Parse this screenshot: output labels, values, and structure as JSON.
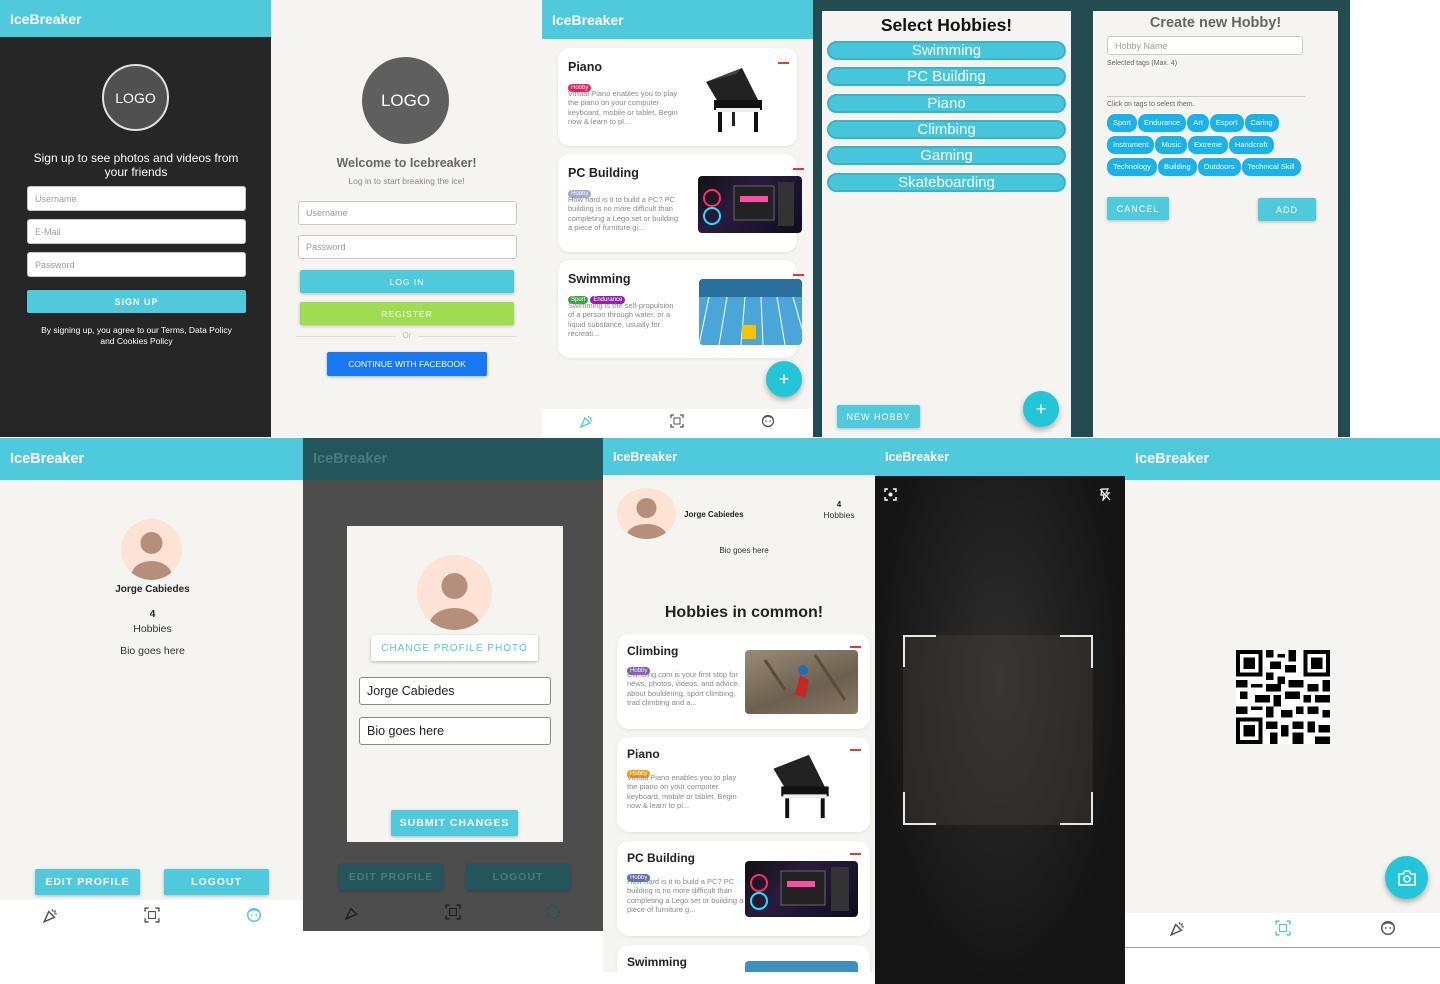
{
  "app_title": "IceBreaker",
  "signup": {
    "logo": "LOGO",
    "tagline": "Sign up to see photos and videos from your friends",
    "username_placeholder": "Username",
    "email_placeholder": "E-Mail",
    "password_placeholder": "Password",
    "signup_button": "SIGN UP",
    "terms": "By signing up, you agree to our Terms, Data Policy and Cookies Policy"
  },
  "login": {
    "logo": "LOGO",
    "welcome": "Welcome to Icebreaker!",
    "subtitle": "Log in to start breaking the ice!",
    "username_placeholder": "Username",
    "password_placeholder": "Password",
    "login_button": "LOG IN",
    "register_button": "REGISTER",
    "or": "Or",
    "facebook_button": "CONTINUE WITH FACEBOOK"
  },
  "hobby_list": {
    "cards": [
      {
        "title": "Piano",
        "tags": [
          {
            "label": "Hobby",
            "color": "#e91e63"
          }
        ],
        "description": "Virtual Piano enables you to play the piano on your computer keyboard, mobile or tablet. Begin now & learn to pl..."
      },
      {
        "title": "PC Building",
        "tags": [
          {
            "label": "Hobby",
            "color": "#9fa8c8"
          }
        ],
        "description": "How hard is it to build a PC? PC building is no more difficult than completing a Lego set or building a piece of furniture gi..."
      },
      {
        "title": "Swimming",
        "tags": [
          {
            "label": "Sport",
            "color": "#43a047"
          },
          {
            "label": "Endurance",
            "color": "#8e24aa"
          }
        ],
        "description": "Swimming is the self-propulsion of a person through water, or a liquid substance, usually for recreati..."
      }
    ],
    "fab": "+"
  },
  "select_hobbies": {
    "title": "Select Hobbies!",
    "items": [
      "Swimming",
      "PC Building",
      "Piano",
      "Climbing",
      "Gaming",
      "Skateboarding"
    ],
    "new_hobby_button": "NEW HOBBY",
    "fab": "+"
  },
  "create_hobby": {
    "title": "Create new Hobby!",
    "name_placeholder": "Hobby Name",
    "selected_tags": "Selected tags (Max. 4)",
    "instructions": "Click on tags to select them.",
    "tags": [
      "Sport",
      "Endurance",
      "Art",
      "Esport",
      "Caring",
      "Instrument",
      "Music",
      "Extreme",
      "Handcraft",
      "Technology",
      "Building",
      "Outdoors",
      "Technical Skill"
    ],
    "cancel_button": "CANCEL",
    "add_button": "ADD"
  },
  "profile": {
    "name": "Jorge Cabiedes",
    "hobbies_count": "4",
    "hobbies_label": "Hobbies",
    "bio": "Bio goes here",
    "edit_button": "EDIT PROFILE",
    "logout_button": "LOGOUT"
  },
  "edit_profile": {
    "change_photo_button": "CHANGE PROFILE PHOTO",
    "name_value": "Jorge Cabiedes",
    "bio_value": "Bio goes here",
    "submit_button": "SUBMIT CHANGES",
    "edit_button": "EDIT PROFILE",
    "logout_button": "LOGOUT"
  },
  "other_profile": {
    "name": "Jorge Cabiedes",
    "hobbies_count": "4",
    "hobbies_label": "Hobbies",
    "bio": "Bio goes here",
    "common_title": "Hobbies in common!",
    "cards": [
      {
        "title": "Climbing",
        "tags": [
          {
            "label": "Hobby",
            "color": "#7e57c2"
          }
        ],
        "description": "Climbing.com is your first stop for news, photos, videos, and advice about bouldering, sport climbing, trad climbing and a..."
      },
      {
        "title": "Piano",
        "tags": [
          {
            "label": "Hobby",
            "color": "#f39c12"
          }
        ],
        "description": "Virtual Piano enables you to play the piano on your computer keyboard, mobile or tablet. Begin now & learn to pl..."
      },
      {
        "title": "PC Building",
        "tags": [
          {
            "label": "Hobby",
            "color": "#5c6bc0"
          }
        ],
        "description": "How hard is it to build a PC? PC building is no more difficult than completing a Lego set or building a piece of furniture g..."
      },
      {
        "title": "Swimming",
        "tags": [],
        "description": ""
      }
    ]
  },
  "nav_icons": [
    "party-popper-icon",
    "qr-scan-icon",
    "face-icon"
  ]
}
